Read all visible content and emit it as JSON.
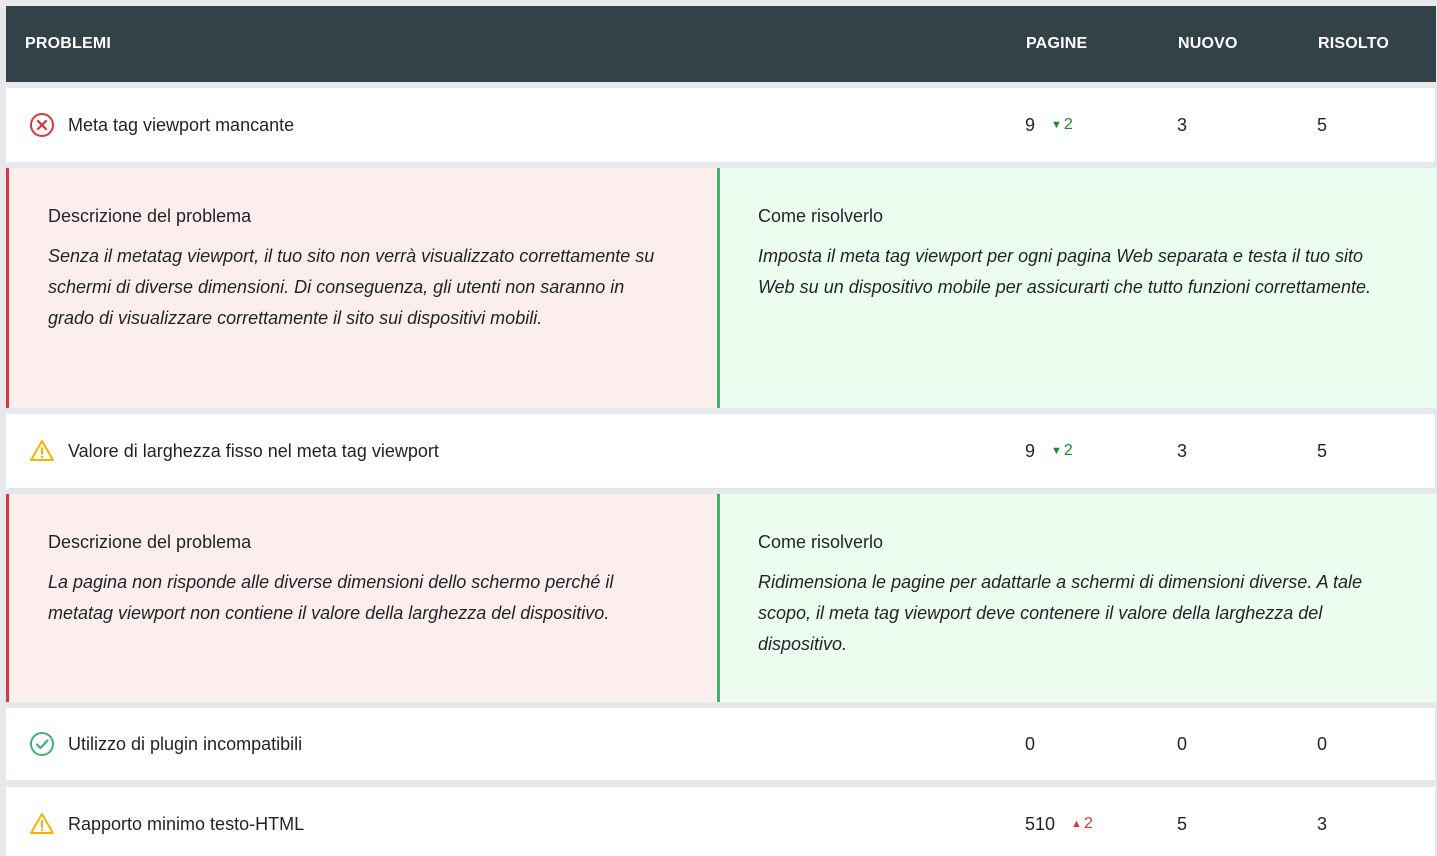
{
  "header": {
    "problems": "PROBLEMI",
    "pages": "PAGINE",
    "new": "NUOVO",
    "resolved": "RISOLTO"
  },
  "rows": [
    {
      "label": "Meta tag viewport mancante",
      "icon": "error-circle-icon",
      "pages": "9",
      "delta": "2",
      "delta_dir": "down",
      "new": "3",
      "resolved": "5",
      "detail": {
        "desc_title": "Descrizione del problema",
        "desc_text": "Senza il metatag viewport, il tuo sito non verrà visualizzato correttamente su schermi di diverse dimensioni. Di conseguenza, gli utenti non saranno in grado di visualizzare correttamente il sito sui dispositivi mobili.",
        "fix_title": "Come risolverlo",
        "fix_text": "Imposta il meta tag viewport per ogni pagina Web separata e testa il tuo sito Web su un dispositivo mobile per assicurarti che tutto funzioni correttamente."
      }
    },
    {
      "label": "Valore di larghezza fisso nel meta tag viewport",
      "icon": "warning-triangle-icon",
      "pages": "9",
      "delta": "2",
      "delta_dir": "down",
      "new": "3",
      "resolved": "5",
      "detail": {
        "desc_title": "Descrizione del problema",
        "desc_text": "La pagina non risponde alle diverse dimensioni dello schermo perché il metatag viewport non contiene il valore della larghezza del dispositivo.",
        "fix_title": "Come risolverlo",
        "fix_text": "Ridimensiona le pagine per adattarle a schermi di dimensioni diverse. A tale scopo, il meta tag viewport deve contenere il valore della larghezza del dispositivo."
      }
    },
    {
      "label": "Utilizzo di plugin incompatibili",
      "icon": "check-circle-icon",
      "pages": "0",
      "new": "0",
      "resolved": "0"
    },
    {
      "label": "Rapporto minimo testo-HTML",
      "icon": "warning-triangle-icon",
      "pages": "510",
      "delta": "2",
      "delta_dir": "up",
      "new": "5",
      "resolved": "3"
    }
  ],
  "colors": {
    "header_bg": "#334249",
    "error": "#d9363e",
    "warning": "#f2b400",
    "success": "#3cb371",
    "delta_down": "#1b8a2e",
    "delta_up": "#d93838",
    "desc_bg": "#fdeeee",
    "fix_bg": "#ecfdf0"
  }
}
